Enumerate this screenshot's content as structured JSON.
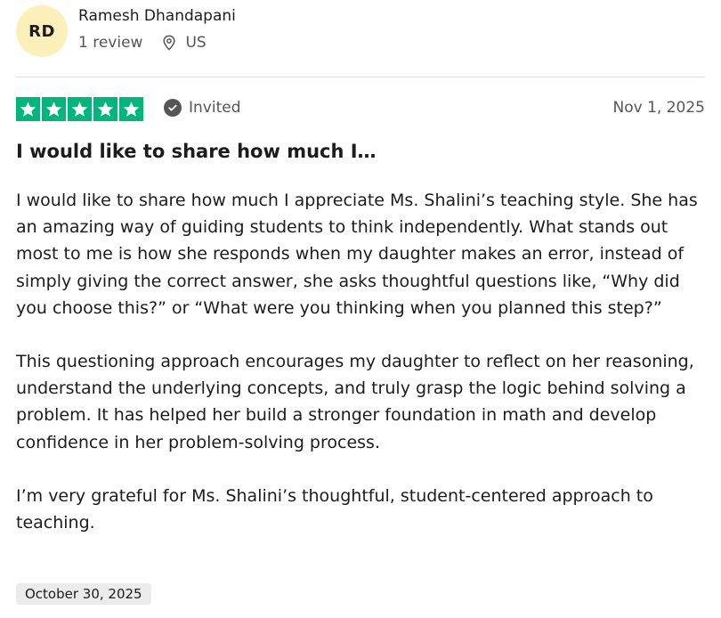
{
  "reviewer": {
    "initials": "RD",
    "name": "Ramesh Dhandapani",
    "review_count": "1 review",
    "location": "US"
  },
  "rating": {
    "stars": 5,
    "max": 5,
    "color": "#00b67a"
  },
  "badge": {
    "label": "Invited"
  },
  "review": {
    "date": "Nov 1, 2025",
    "title": "I would like to share how much I…",
    "paragraphs": [
      "I would like to share how much I appreciate Ms. Shalini’s teaching style. She has an amazing way of guiding students to think independently. What stands out most to me is how she responds when my daughter makes an error, instead of simply giving the correct answer, she asks thoughtful questions like, “Why did you choose this?” or “What were you thinking when you planned this step?”",
      "This questioning approach encourages my daughter to reflect on her reasoning, understand the underlying concepts, and truly grasp the logic behind solving a problem. It has helped her build a stronger foundation in math and develop confidence in her problem-solving process.",
      "I’m very grateful for Ms. Shalini’s thoughtful, student-centered approach to teaching."
    ],
    "experience_date": "October 30, 2025"
  },
  "icons": {
    "location": "location-pin-icon",
    "star": "star-icon",
    "invited": "check-circle-icon"
  }
}
